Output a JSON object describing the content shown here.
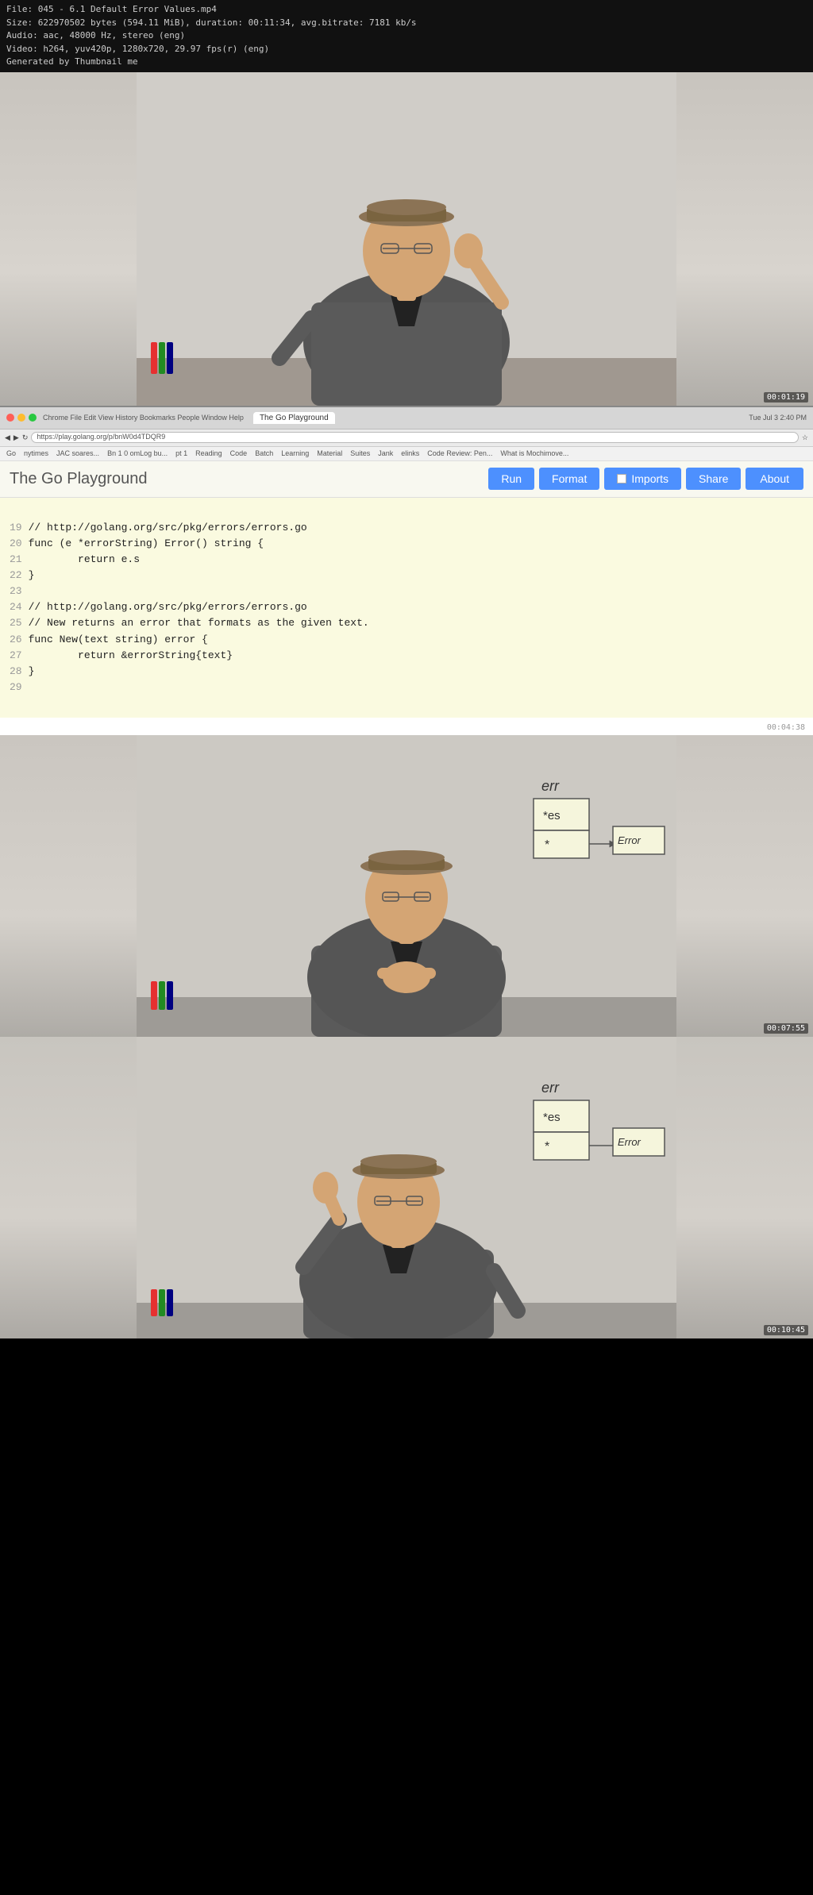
{
  "file_info": {
    "line1": "File: 045 - 6.1 Default Error Values.mp4",
    "line2": "Size: 622970502 bytes (594.11 MiB), duration: 00:11:34, avg.bitrate: 7181 kb/s",
    "line3": "Audio: aac, 48000 Hz, stereo (eng)",
    "line4": "Video: h264, yuv420p, 1280x720, 29.97 fps(r) (eng)",
    "line5": "Generated by Thumbnail me"
  },
  "timestamps": {
    "scene1": "00:01:19",
    "scene2": "00:04:38",
    "scene3": "00:07:55",
    "scene4": "00:10:45"
  },
  "browser": {
    "tab_title": "The Go Playground",
    "url": "https://play.golang.org/p/bnW0d4TDQR9",
    "bookmarks": [
      "Go",
      "nytimes",
      "JAC soares...",
      "Bn 1 0 omLog bu...",
      "pt 1",
      "Reading",
      "Code",
      "Batch",
      "Learning",
      "Material",
      "Suites",
      "Jank",
      "elinks",
      "Code Review: Pen...",
      "What is Mochimove..."
    ]
  },
  "playground": {
    "title": "The Go Playground",
    "buttons": {
      "run": "Run",
      "format": "Format",
      "imports": "Imports",
      "share": "Share",
      "about": "About"
    },
    "code_lines": [
      {
        "num": "19",
        "text": "// http://golang.org/src/pkg/errors/errors.go"
      },
      {
        "num": "20",
        "text": "func (e *errorString) Error() string {"
      },
      {
        "num": "21",
        "text": "        return e.s"
      },
      {
        "num": "22",
        "text": "}"
      },
      {
        "num": "23",
        "text": ""
      },
      {
        "num": "24",
        "text": "// http://golang.org/src/pkg/errors/errors.go"
      },
      {
        "num": "25",
        "text": "// New returns an error that formats as the given text."
      },
      {
        "num": "26",
        "text": "func New(text string) error {"
      },
      {
        "num": "27",
        "text": "        return &errorString{text}"
      },
      {
        "num": "28",
        "text": "}"
      },
      {
        "num": "29",
        "text": ""
      }
    ]
  },
  "diagram": {
    "label_err": "err",
    "label_es": "*es",
    "label_error": "Error",
    "label_ptr": "*"
  },
  "colors": {
    "bg_presenter": "#e0ddd8",
    "bg_code": "#fafae0",
    "btn_blue": "#4d90fe",
    "browser_chrome": "#d6d6d6"
  }
}
